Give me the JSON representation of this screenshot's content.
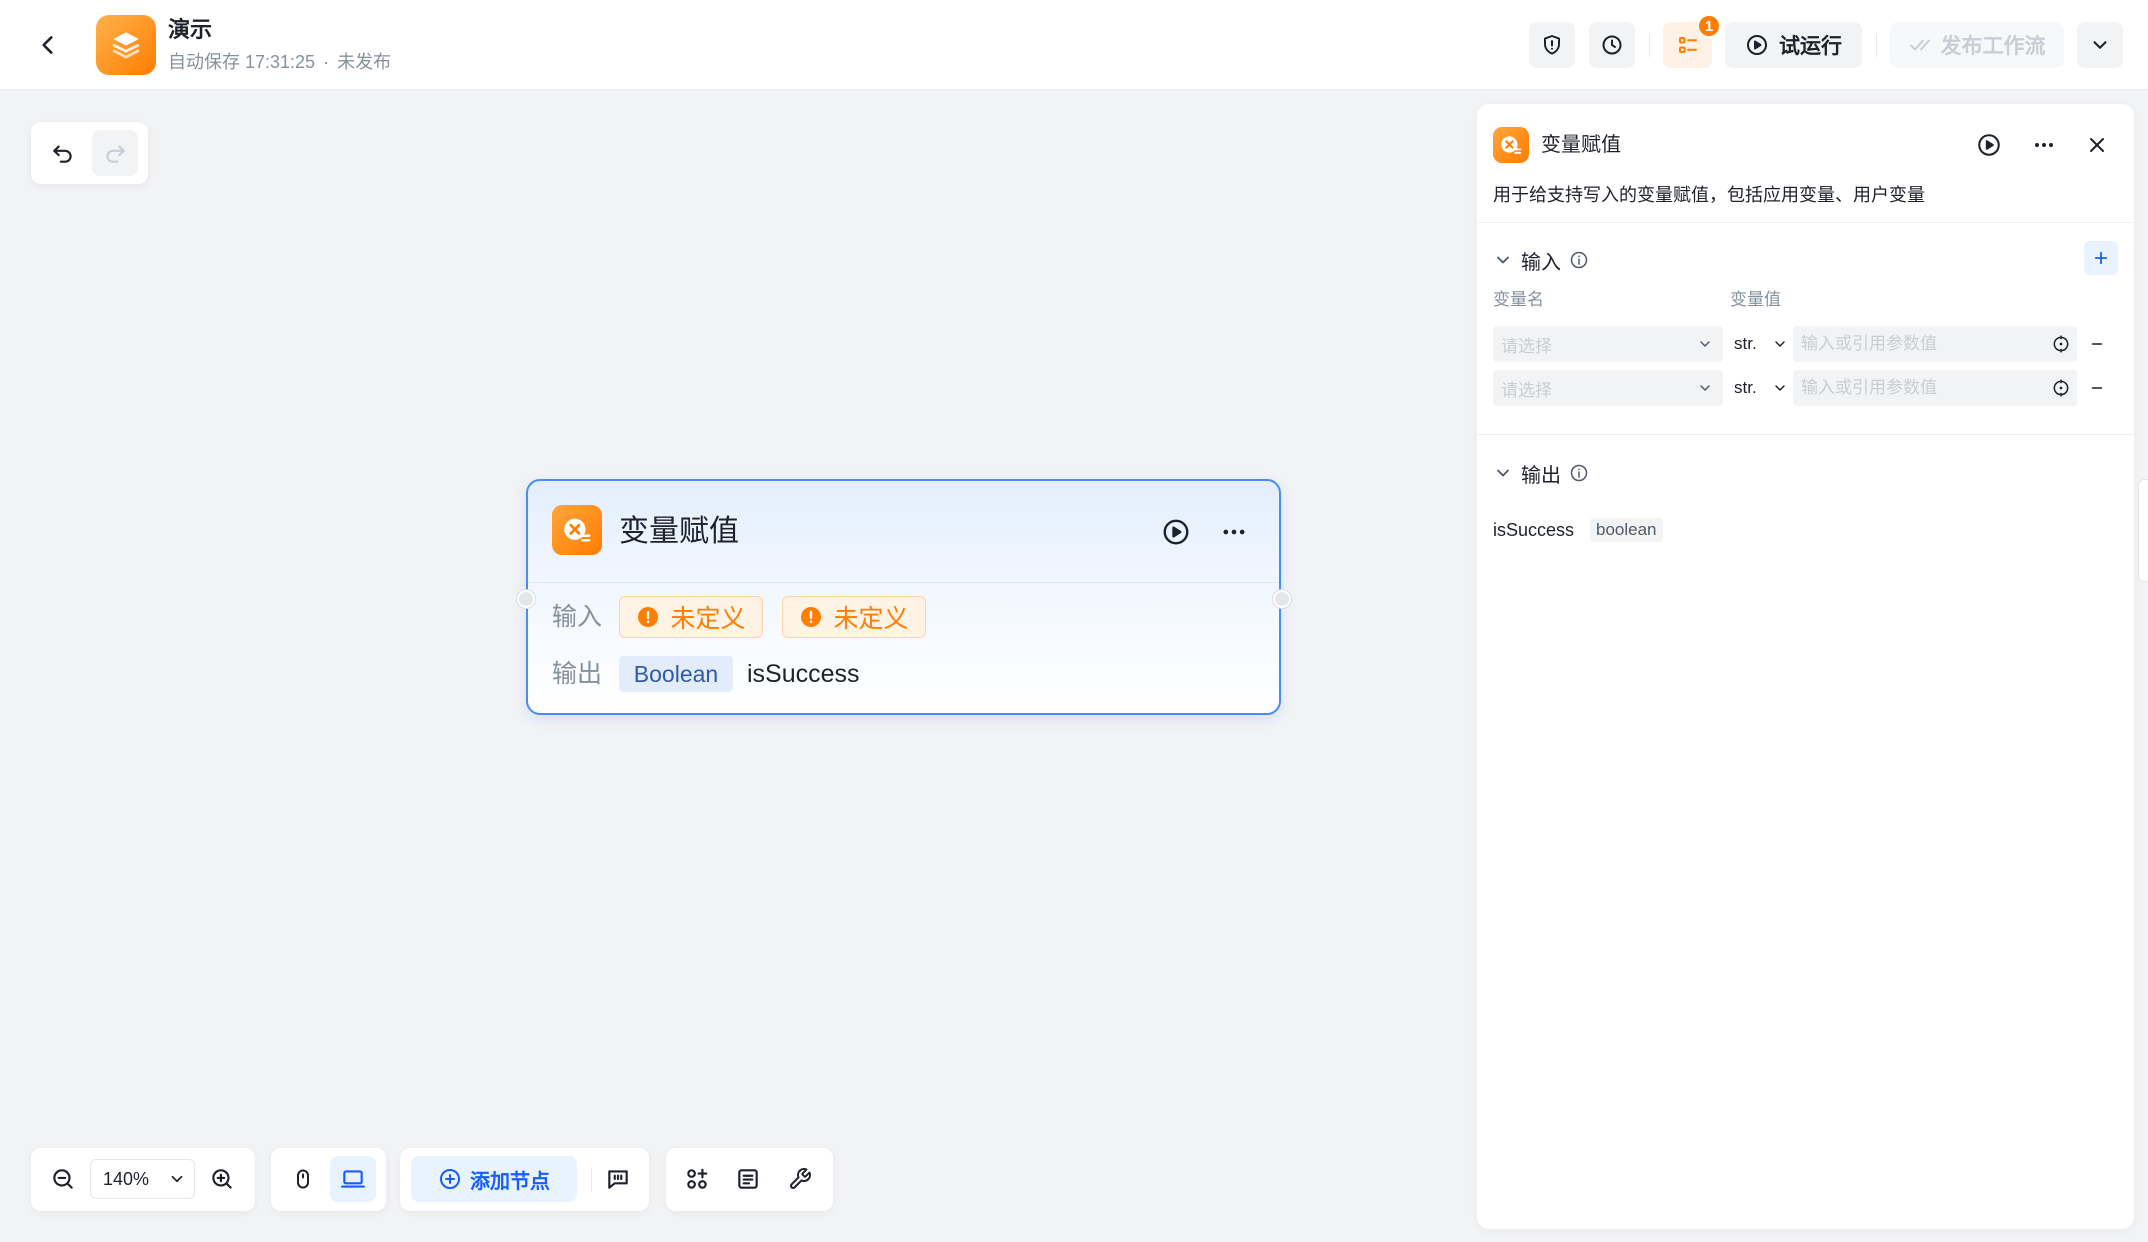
{
  "header": {
    "title": "演示",
    "autosave": "自动保存 17:31:25",
    "separator": "·",
    "status": "未发布",
    "issues_badge": "1",
    "run_label": "试运行",
    "publish_label": "发布工作流"
  },
  "node": {
    "title": "变量赋值",
    "input_label": "输入",
    "input_tags": [
      "未定义",
      "未定义"
    ],
    "output_label": "输出",
    "output_type": "Boolean",
    "output_name": "isSuccess"
  },
  "panel": {
    "title": "变量赋值",
    "description": "用于给支持写入的变量赋值，包括应用变量、用户变量",
    "inputs": {
      "label": "输入",
      "col_name": "变量名",
      "col_value": "变量值",
      "rows": [
        {
          "name_placeholder": "请选择",
          "type": "str.",
          "value": "",
          "value_placeholder": "输入或引用参数值"
        },
        {
          "name_placeholder": "请选择",
          "type": "str.",
          "value": "",
          "value_placeholder": "输入或引用参数值"
        }
      ]
    },
    "outputs": {
      "label": "输出",
      "items": [
        {
          "name": "isSuccess",
          "type": "boolean"
        }
      ]
    }
  },
  "toolbar": {
    "zoom": "140%",
    "add_node_label": "添加节点",
    "active_mode": "laptop-icon"
  },
  "colors": {
    "accent": "#165dff",
    "warning": "#ff7d00",
    "node_border": "#4a8cf7",
    "canvas": "#f2f3f5"
  }
}
